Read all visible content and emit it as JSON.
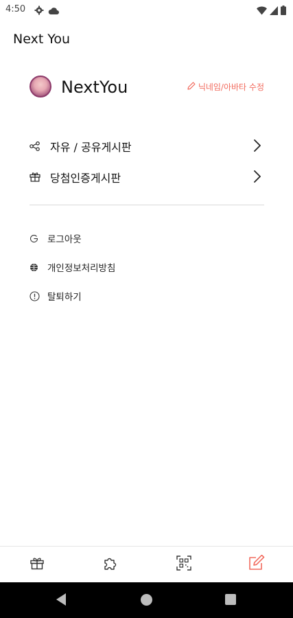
{
  "status_bar": {
    "time": "4:50",
    "left_icons": [
      "gear-icon",
      "cloud-icon"
    ],
    "right_icons": [
      "wifi-icon",
      "signal-icon",
      "battery-icon"
    ]
  },
  "app_bar": {
    "title": "Next You"
  },
  "profile": {
    "name": "NextYou",
    "edit_label": "닉네임/아바타 수정",
    "accent_color": "#f26b5e"
  },
  "menu": {
    "items": [
      {
        "label": "자유 / 공유게시판",
        "icon": "share-icon"
      },
      {
        "label": "당첨인증게시판",
        "icon": "gift-icon"
      }
    ]
  },
  "sub_menu": {
    "items": [
      {
        "label": "로그아웃",
        "icon": "logout-icon"
      },
      {
        "label": "개인정보처리방침",
        "icon": "globe-icon"
      },
      {
        "label": "탈퇴하기",
        "icon": "alert-icon"
      }
    ]
  },
  "bottom_nav": {
    "items": [
      "gift-tab-icon",
      "puzzle-tab-icon",
      "qr-scan-tab-icon",
      "edit-tab-icon"
    ],
    "active": "edit-tab-icon"
  }
}
